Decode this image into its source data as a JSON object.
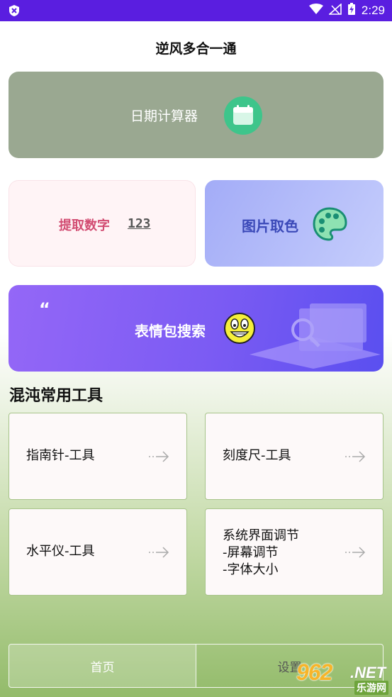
{
  "status_bar": {
    "time": "2:29"
  },
  "app": {
    "title": "逆风多合一通"
  },
  "cards": {
    "date_calc": {
      "label": "日期计算器",
      "icon": "calendar-icon"
    },
    "extract_num": {
      "label": "提取数字",
      "icon_text": "123"
    },
    "pick_color": {
      "label": "图片取色",
      "icon": "palette-icon"
    },
    "emoji_search": {
      "label": "表情包搜索",
      "quote": "“",
      "icon": "smiley-face-icon"
    }
  },
  "section": {
    "title": "混沌常用工具"
  },
  "tools": [
    {
      "lines": [
        "指南针-工具"
      ]
    },
    {
      "lines": [
        "刻度尺-工具"
      ]
    },
    {
      "lines": [
        "水平仪-工具"
      ]
    },
    {
      "lines": [
        "系统界面调节",
        "-屏幕调节",
        "-字体大小"
      ]
    }
  ],
  "tabs": {
    "home": "首页",
    "settings": "设置"
  },
  "watermark": {
    "num": "962",
    "net": ".NET",
    "cn": "乐游网"
  },
  "colors": {
    "status_bar": "#5a1ee0",
    "date_card": "#9aa891",
    "calendar_green": "#3ec58b",
    "num_label": "#d24c72",
    "color_label": "#3b49b8",
    "emoji_card": "#7b5bf3",
    "tool_border": "#a7c48a",
    "bg_bottom": "#93bb6a"
  }
}
